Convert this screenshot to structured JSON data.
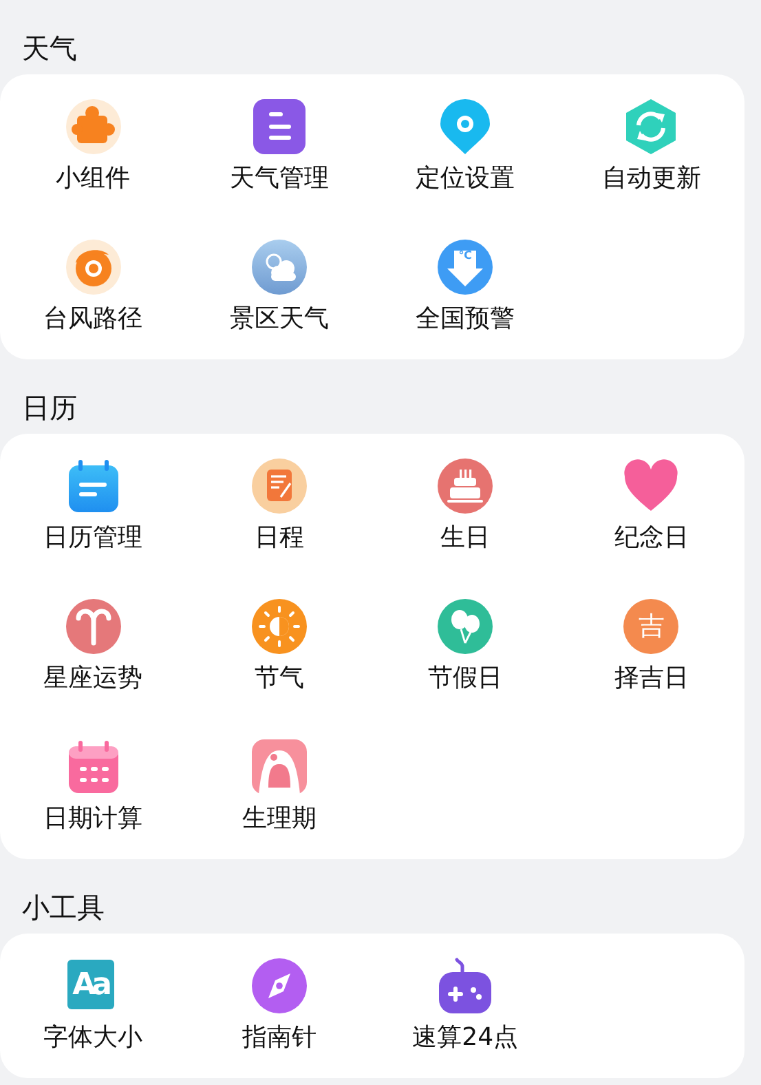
{
  "sections": [
    {
      "title": "天气",
      "items": [
        {
          "label": "小组件"
        },
        {
          "label": "天气管理"
        },
        {
          "label": "定位设置"
        },
        {
          "label": "自动更新"
        },
        {
          "label": "台风路径"
        },
        {
          "label": "景区天气"
        },
        {
          "label": "全国预警",
          "glyph": "℃"
        }
      ]
    },
    {
      "title": "日历",
      "items": [
        {
          "label": "日历管理"
        },
        {
          "label": "日程"
        },
        {
          "label": "生日"
        },
        {
          "label": "纪念日"
        },
        {
          "label": "星座运势"
        },
        {
          "label": "节气"
        },
        {
          "label": "节假日"
        },
        {
          "label": "择吉日",
          "glyph": "吉"
        },
        {
          "label": "日期计算"
        },
        {
          "label": "生理期"
        }
      ]
    },
    {
      "title": "小工具",
      "items": [
        {
          "label": "字体大小",
          "glyph": "Aa"
        },
        {
          "label": "指南针"
        },
        {
          "label": "速算24点"
        }
      ]
    }
  ]
}
